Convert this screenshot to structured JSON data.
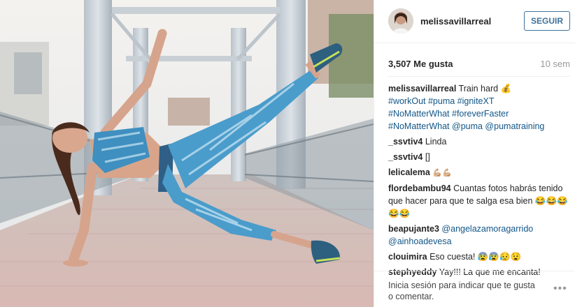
{
  "post": {
    "username": "melissavillarreal",
    "follow_label": "SEGUIR",
    "likes": "3,507 Me gusta",
    "time": "10 sem"
  },
  "comments": [
    {
      "user": "melissavillarreal",
      "text": "Train hard 💰",
      "tags": "#workOut #puma #igniteXT\n#NoMatterWhat #foreverFaster\n#NoMatterWhat @puma @pumatraining"
    },
    {
      "user": "_ssvtiv4",
      "text": "Linda"
    },
    {
      "user": "_ssvtiv4",
      "text": "[]"
    },
    {
      "user": "lelicalema",
      "text": "💪🏼💪🏼"
    },
    {
      "user": "flordebambu94",
      "text": "Cuantas fotos habrás tenido que hacer para que te salga esa bien 😂😂😂😂😂"
    },
    {
      "user": "beapujante3",
      "tags": "@angelazamoragarrido @ainhoadevesa"
    },
    {
      "user": "clouimira",
      "text": "Eso cuesta! 😰😰😥😧"
    },
    {
      "user": "stephyeddy",
      "text": "Yay!!! La que me encanta!"
    }
  ],
  "footer": {
    "login_text": "Inicia sesión para indicar que te gusta o comentar.",
    "more_label": "•••"
  }
}
